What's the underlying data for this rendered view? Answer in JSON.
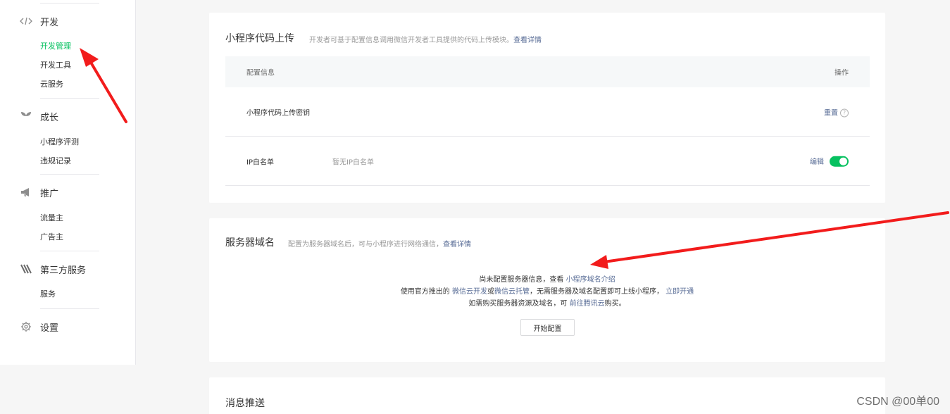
{
  "sidebar": {
    "groups": [
      {
        "title": "开发",
        "icon": "code-icon",
        "items": [
          "开发管理",
          "开发工具",
          "云服务"
        ]
      },
      {
        "title": "成长",
        "icon": "sprout-icon",
        "items": [
          "小程序评测",
          "违规记录"
        ]
      },
      {
        "title": "推广",
        "icon": "megaphone-icon",
        "items": [
          "流量主",
          "广告主"
        ]
      },
      {
        "title": "第三方服务",
        "icon": "third-party-icon",
        "items": [
          "服务"
        ]
      },
      {
        "title": "设置",
        "icon": "gear-icon",
        "items": []
      }
    ],
    "active_item": "开发管理"
  },
  "upload_panel": {
    "title": "小程序代码上传",
    "desc": "开发者可基于配置信息调用微信开发者工具提供的代码上传模块。",
    "desc_link": "查看详情",
    "table_header": {
      "config": "配置信息",
      "action": "操作"
    },
    "rows": [
      {
        "label": "小程序代码上传密钥",
        "value": "",
        "action": "重置"
      },
      {
        "label": "IP白名单",
        "value": "暂无IP白名单",
        "action": "编辑",
        "toggle_on": true
      }
    ]
  },
  "domain_panel": {
    "title": "服务器域名",
    "desc": "配置为服务器域名后，可与小程序进行网络通信，",
    "desc_link": "查看详情",
    "line1_text": "尚未配置服务器信息，查看",
    "line1_link": "小程序域名介绍",
    "line2_text_a": "使用官方推出的",
    "line2_link_a": "微信云开发",
    "line2_text_b": "或",
    "line2_link_b": "微信云托管",
    "line2_text_c": "，无需服务器及域名配置即可上线小程序，",
    "line2_link_c": "立即开通",
    "line3_text_a": "如需购买服务器资源及域名，可",
    "line3_link": "前往腾讯云",
    "line3_text_b": "购买。",
    "button": "开始配置"
  },
  "message_panel": {
    "title": "消息推送"
  },
  "watermark": "CSDN @00单00",
  "colors": {
    "accent_green": "#07c160",
    "link_blue": "#576b95",
    "arrow_red": "#f21c1c"
  }
}
